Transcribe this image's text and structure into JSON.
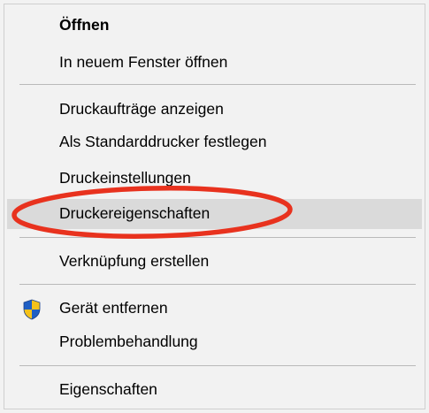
{
  "menu": {
    "items": [
      {
        "label": "Öffnen"
      },
      {
        "label": "In neuem Fenster öffnen"
      },
      {
        "label": "Druckaufträge anzeigen"
      },
      {
        "label": "Als Standarddrucker festlegen"
      },
      {
        "label": "Druckeinstellungen"
      },
      {
        "label": "Druckereigenschaften"
      },
      {
        "label": "Verknüpfung erstellen"
      },
      {
        "label": "Gerät entfernen",
        "icon": "uac-shield-icon"
      },
      {
        "label": "Problembehandlung"
      },
      {
        "label": "Eigenschaften"
      }
    ]
  },
  "colors": {
    "menu_background": "#f2f2f2",
    "highlight": "#dadada",
    "annotation_ellipse": "#e8321e",
    "shield_blue": "#1f5fc4",
    "shield_yellow": "#f5c21b"
  }
}
